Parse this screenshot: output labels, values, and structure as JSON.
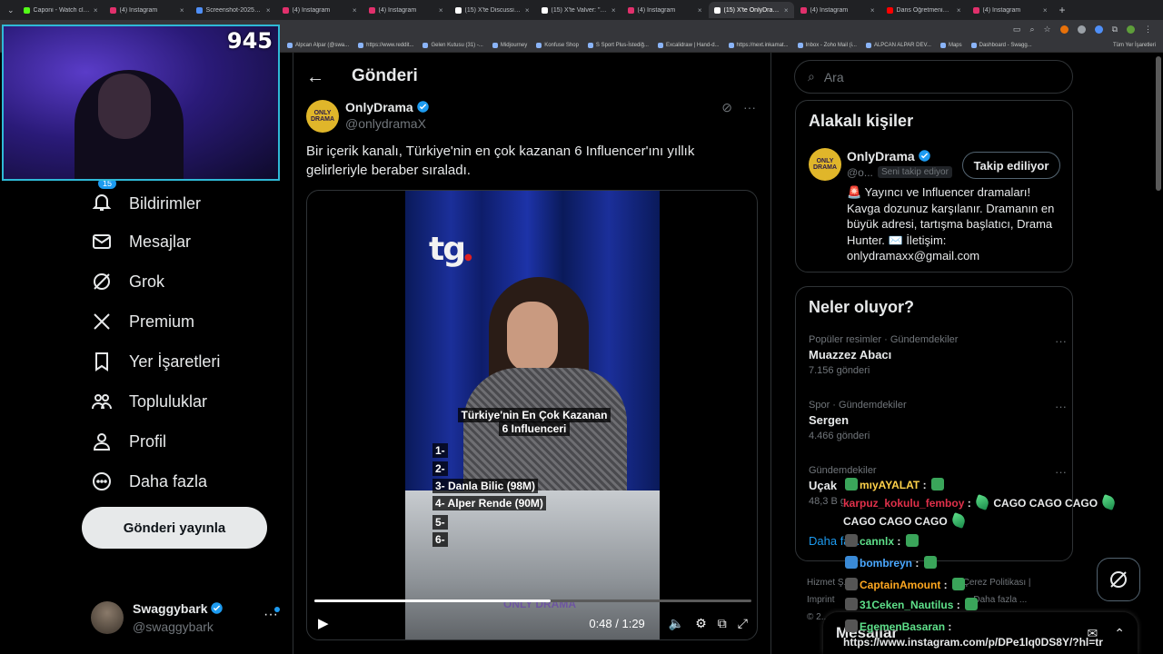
{
  "browser": {
    "tabs": [
      {
        "title": "Caponi - Watch clips",
        "color": "#53fc18"
      },
      {
        "title": "(4) Instagram",
        "color": "#e1306c"
      },
      {
        "title": "Screenshot-2025-11-1",
        "color": "#4f8ff7"
      },
      {
        "title": "(4) Instagram",
        "color": "#e1306c"
      },
      {
        "title": "(4) Instagram",
        "color": "#e1306c"
      },
      {
        "title": "(15) X'te DiscussingFil",
        "color": "#ffffff"
      },
      {
        "title": "(15) X'te Valver: \"Anne",
        "color": "#ffffff"
      },
      {
        "title": "(4) Instagram",
        "color": "#e1306c"
      },
      {
        "title": "(15) X'te OnlyDrama: \"",
        "color": "#ffffff"
      },
      {
        "title": "(4) Instagram",
        "color": "#e1306c"
      },
      {
        "title": "Dans Öğretmenim Jer",
        "color": "#ff0000"
      },
      {
        "title": "(4) Instagram",
        "color": "#e1306c"
      }
    ],
    "active_tab_index": 8,
    "bookmarks": [
      "Alpcan Alpar (@swa...",
      "https://www.reddit...",
      "Gelen Kutusu (31) -...",
      "Midjourney",
      "Konfuse Shop",
      "S Sport Plus-İstediğ...",
      "Excalidraw | Hand-d...",
      "https://next.inkamat...",
      "Inbox - Zoho Mail (i...",
      "ALPCAN ALPAR DEV...",
      "Maps",
      "Dashboard - Swagg..."
    ],
    "all_bookmarks": "Tüm Yer İşaretleri"
  },
  "webcam": {
    "count": "945"
  },
  "nav": {
    "notif_badge": "15",
    "items": [
      "Bildirimler",
      "Mesajlar",
      "Grok",
      "Premium",
      "Yer İşaretleri",
      "Topluluklar",
      "Profil",
      "Daha fazla"
    ],
    "post_button": "Gönderi yayınla"
  },
  "account": {
    "name": "Swaggybark",
    "handle": "@swaggybark"
  },
  "main": {
    "title": "Gönderi",
    "author": {
      "name": "OnlyDrama",
      "handle": "@onlydramaX",
      "avatar_text": "ONLY DRAMA"
    },
    "text": "Bir içerik kanalı, Türkiye'nin en çok kazanan 6 Influencer'ını yıllık gelirleriyle beraber sıraladı.",
    "video": {
      "overlay_title_1": "Türkiye'nin En Çok Kazanan",
      "overlay_title_2": "6 Influenceri",
      "ranks": [
        "1-",
        "2-",
        "3- Danla Bilic (98M)",
        "4- Alper Rende (90M)",
        "5-",
        "6-"
      ],
      "watermark": "ONLY DRAMA",
      "logo": "tg",
      "time": "0:48 / 1:29",
      "progress": 0.54
    }
  },
  "search": {
    "placeholder": "Ara"
  },
  "related": {
    "title": "Alakalı kişiler",
    "name": "OnlyDrama",
    "handle": "@o...",
    "follows_you": "Seni takip ediyor",
    "follow_button": "Takip ediliyor",
    "bio": "🚨 Yayıncı ve Influencer dramaları! Kavga dozunuz karşılanır. Dramanın en büyük adresi, tartışma başlatıcı, Drama Hunter. ✉️ İletişim: onlydramaxx@gmail.com"
  },
  "trends": {
    "title": "Neler oluyor?",
    "items": [
      {
        "meta": "Popüler resimler · Gündemdekiler",
        "name": "Muazzez Abacı",
        "count": "7.156 gönderi"
      },
      {
        "meta": "Spor · Gündemdekiler",
        "name": "Sergen",
        "count": "4.466 gönderi"
      },
      {
        "meta": "Gündemdekiler",
        "name": "Uçak",
        "count": "48,3 B g..."
      }
    ],
    "show_more": "Daha fa..."
  },
  "footer": {
    "l1": "Hizmet Ş...",
    "l1b": "Çerez Politikası |",
    "l2": "Imprint",
    "l2b": "Daha fazla ...",
    "l3": "© 2..."
  },
  "chat": {
    "lines": [
      {
        "user": "mıyAYALAT",
        "color": "#ffd24a",
        "msg": ""
      },
      {
        "user": "karpuz_kokulu_femboy",
        "color": "#e0304a",
        "msg": "CAGO  CAGO  CAGO"
      },
      {
        "user": "",
        "color": "#ffffff",
        "msg": "CAGO  CAGO  CAGO"
      },
      {
        "user": "cannlx",
        "color": "#5ee08a",
        "msg": ""
      },
      {
        "user": "bombreyn",
        "color": "#4aa8ff",
        "msg": ""
      },
      {
        "user": "CaptainAmount",
        "color": "#ffa820",
        "msg": ""
      },
      {
        "user": "31Ceken_Nautilus",
        "color": "#5ee08a",
        "msg": ""
      },
      {
        "user": "EgemenBasaran",
        "color": "#5ee08a",
        "msg": ""
      },
      {
        "user": "",
        "color": "#ffffff",
        "msg": "https://www.instagram.com/p/DPe1lq0DS8Y/?hl=tr"
      }
    ]
  },
  "dm": {
    "title": "Mesajlar"
  },
  "colors": {
    "accent": "#1d9bf0",
    "verified": "#1d9bf0"
  }
}
